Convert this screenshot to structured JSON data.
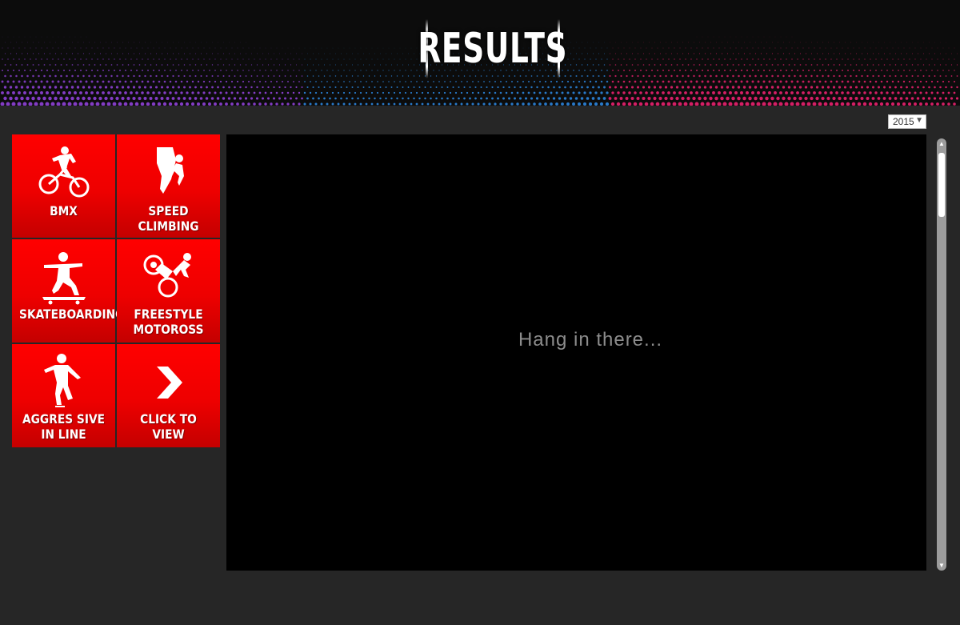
{
  "header": {
    "title": "RESULTS",
    "accent_colors": [
      "#2a7fd4",
      "#e0206a",
      "#8a3fd0"
    ]
  },
  "year_selector": {
    "selected": "2015",
    "caret": "▼"
  },
  "tiles": [
    {
      "label": "BMX",
      "icon": "bmx-rider-icon"
    },
    {
      "label": "SPEED CLIMBING",
      "icon": "climber-icon"
    },
    {
      "label": "SKATEBOARDING",
      "icon": "skateboarder-icon"
    },
    {
      "label": "FREESTYLE\nMOTOROSS",
      "icon": "motocross-icon"
    },
    {
      "label": "AGGRES SIVE\nIN LINE",
      "icon": "inline-skater-icon"
    },
    {
      "label": "CLICK TO VIEW",
      "icon": "chevron-right-icon"
    }
  ],
  "main": {
    "loading_text": "Hang in there..."
  },
  "scrollbar": {
    "up": "▲",
    "down": "▼"
  },
  "colors": {
    "tile_red": "#ff0000",
    "panel": "#000000",
    "page_bg": "#262626"
  }
}
